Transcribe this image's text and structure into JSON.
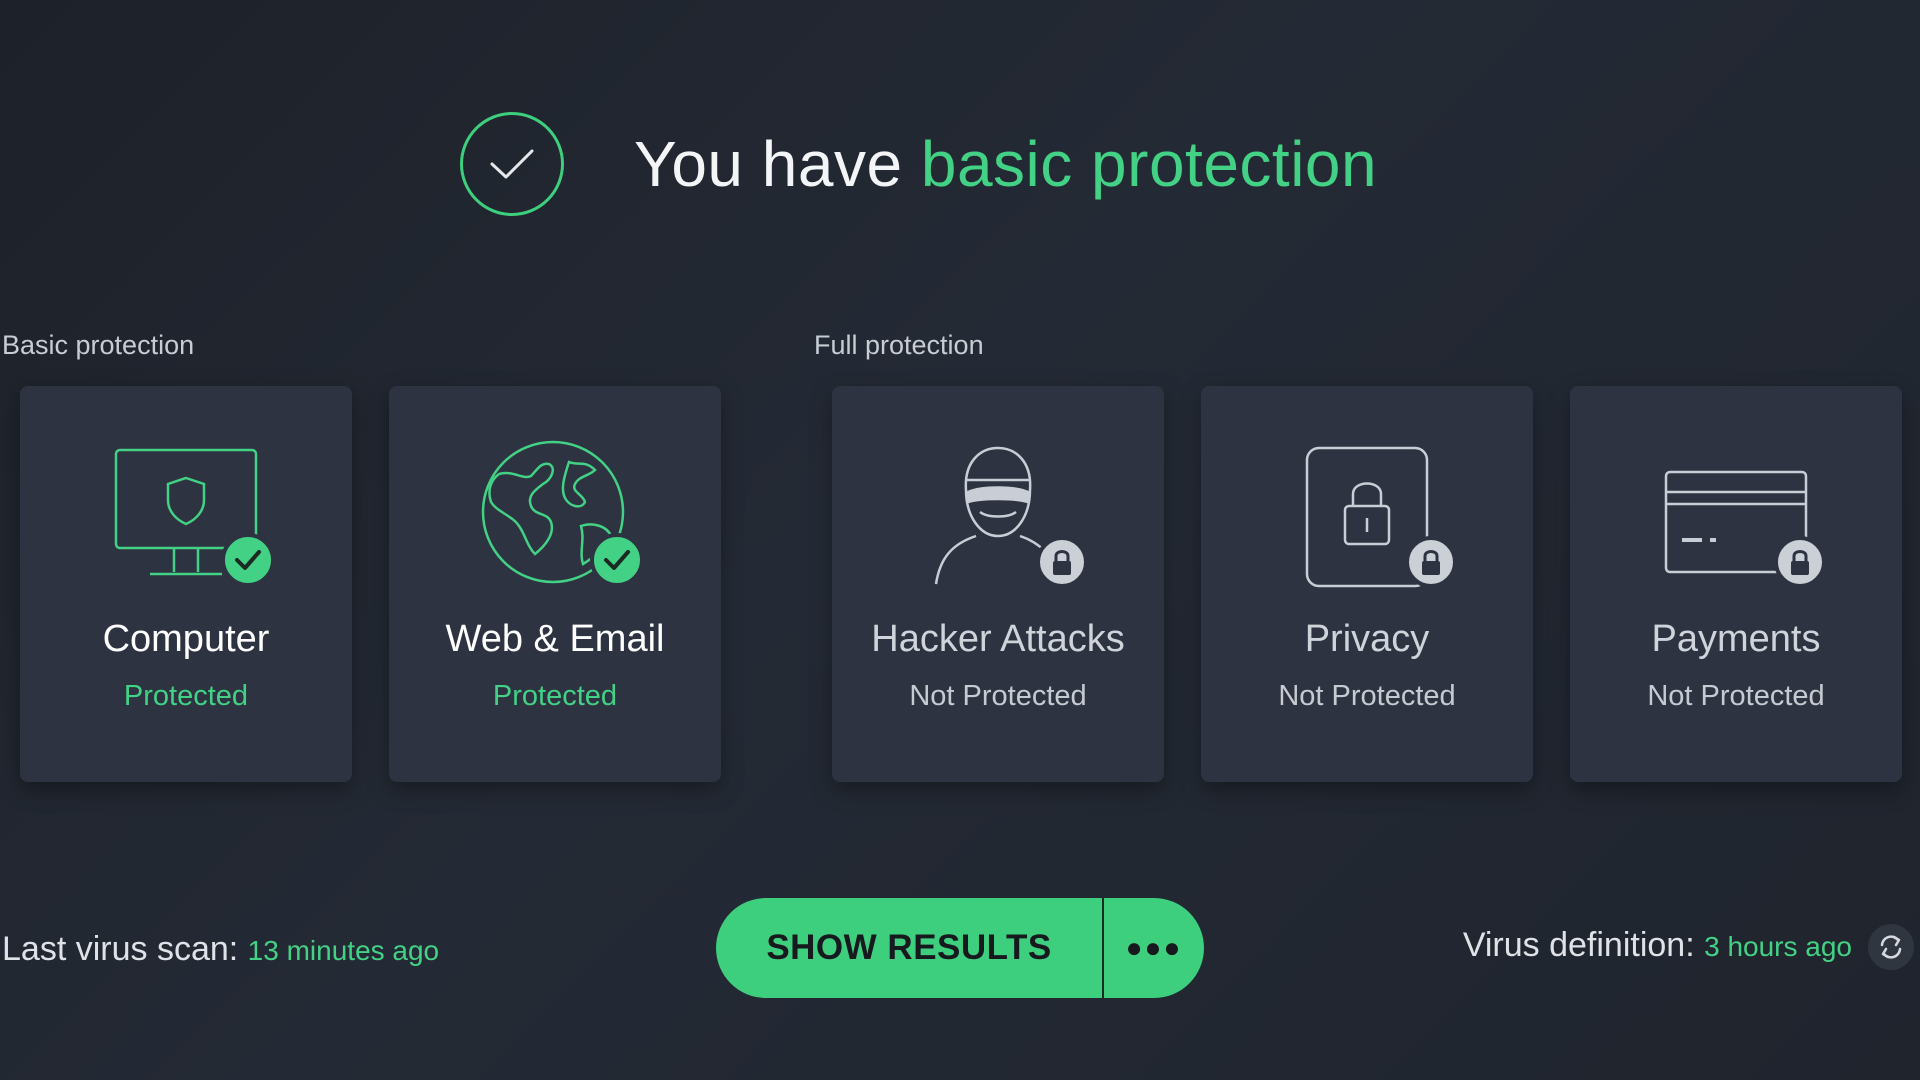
{
  "header": {
    "title_prefix": "You have",
    "title_accent": "basic protection"
  },
  "sections": {
    "basic_label": "Basic protection",
    "full_label": "Full protection"
  },
  "cards": [
    {
      "title": "Computer",
      "status": "Protected",
      "icon": "monitor-shield-icon",
      "badge": "check-badge-icon"
    },
    {
      "title": "Web & Email",
      "status": "Protected",
      "icon": "globe-icon",
      "badge": "check-badge-icon"
    },
    {
      "title": "Hacker Attacks",
      "status": "Not Protected",
      "icon": "hacker-icon",
      "badge": "lock-badge-icon"
    },
    {
      "title": "Privacy",
      "status": "Not Protected",
      "icon": "padlock-icon",
      "badge": "lock-badge-icon"
    },
    {
      "title": "Payments",
      "status": "Not Protected",
      "icon": "credit-card-icon",
      "badge": "lock-badge-icon"
    }
  ],
  "footer": {
    "last_scan_label": "Last virus scan:",
    "last_scan_value": "13 minutes ago",
    "show_results_label": "SHOW RESULTS",
    "more_label": "●●●",
    "virus_definition_label": "Virus definition:",
    "virus_definition_value": "3 hours ago"
  },
  "colors": {
    "accent": "#43d185",
    "background": "#22272f",
    "card": "#2d3341",
    "muted_text": "#c6cad1"
  }
}
